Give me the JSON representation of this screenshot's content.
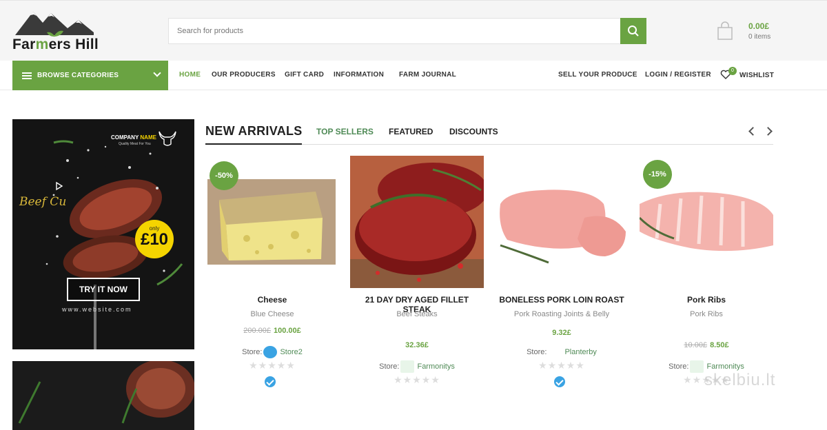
{
  "header": {
    "logo_text_a": "Far",
    "logo_text_b": "m",
    "logo_text_c": "ers Hill",
    "search_placeholder": "Search for products",
    "cart_amount": "0.00£",
    "cart_items": "0 items"
  },
  "nav": {
    "browse_label": "BROWSE CATEGORIES",
    "links": [
      "HOME",
      "OUR PRODUCERS",
      "GIFT CARD",
      "INFORMATION",
      "FARM JOURNAL"
    ],
    "right_links": [
      "SELL YOUR PRODUCE",
      "LOGIN / REGISTER"
    ],
    "wishlist_label": "WISHLIST",
    "wishlist_count": "0"
  },
  "banner": {
    "company": "COMPANY",
    "name": "NAME",
    "tagline": "Quality Meat For You",
    "script_title": "Beef Cu",
    "only": "only",
    "price": "£10",
    "cta": "TRY IT NOW",
    "website": "www.website.com"
  },
  "tabs": [
    "NEW ARRIVALS",
    "TOP SELLERS",
    "FEATURED",
    "DISCOUNTS"
  ],
  "products": [
    {
      "name": "Cheese",
      "category": "Blue Cheese",
      "badge": "-50%",
      "old_price": "200.00£",
      "price": "100.00£",
      "store_label": "Store:",
      "store": "Store2",
      "rating": 0,
      "verified": true
    },
    {
      "name": "21 DAY DRY AGED FILLET STEAK",
      "category": "Beef Steaks",
      "badge": "",
      "old_price": "",
      "price": "32.36£",
      "store_label": "Store:",
      "store": "Farmonitys",
      "rating": 0,
      "verified": false
    },
    {
      "name": "BONELESS PORK LOIN ROAST",
      "category": "Pork Roasting Joints & Belly",
      "badge": "",
      "old_price": "",
      "price": "9.32£",
      "store_label": "Store:",
      "store": "Planterby",
      "rating": 0,
      "verified": true
    },
    {
      "name": "Pork Ribs",
      "category": "Pork Ribs",
      "badge": "-15%",
      "old_price": "10.00£",
      "price": "8.50£",
      "store_label": "Store:",
      "store": "Farmonitys",
      "rating": 0,
      "verified": false
    }
  ],
  "watermark": "skelbiu.lt",
  "colors": {
    "brand_green": "#6aa342",
    "tab_green": "#4f8a56",
    "verified_blue": "#3aa3e3"
  },
  "icons": [
    "search-icon",
    "cart-icon",
    "menu-icon",
    "chevron-down-icon",
    "heart-icon",
    "chevron-left-icon",
    "chevron-right-icon",
    "verified-icon",
    "bull-icon"
  ]
}
